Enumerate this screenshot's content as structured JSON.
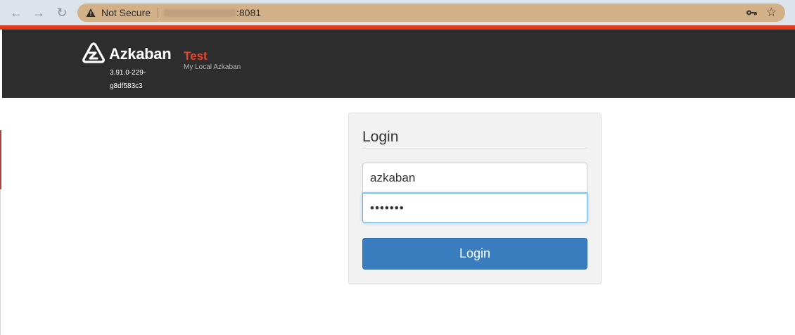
{
  "browser": {
    "security_label": "Not Secure",
    "url_visible": ":8081",
    "icons": {
      "back": "arrow-left-icon",
      "forward": "arrow-right-icon",
      "reload": "reload-icon",
      "warning": "warning-triangle-icon",
      "key": "key-icon",
      "bookmark": "star-icon"
    }
  },
  "header": {
    "brand": "Azkaban",
    "version": "3.91.0-229-g8df583c3",
    "environment_name": "Test",
    "environment_description": "My Local Azkaban",
    "colors": {
      "accent": "#e03a1e",
      "background": "#2d2d2d"
    }
  },
  "login": {
    "title": "Login",
    "username_value": "azkaban",
    "password_value": "•••••••",
    "button_label": "Login",
    "button_color": "#3a7dbf"
  }
}
